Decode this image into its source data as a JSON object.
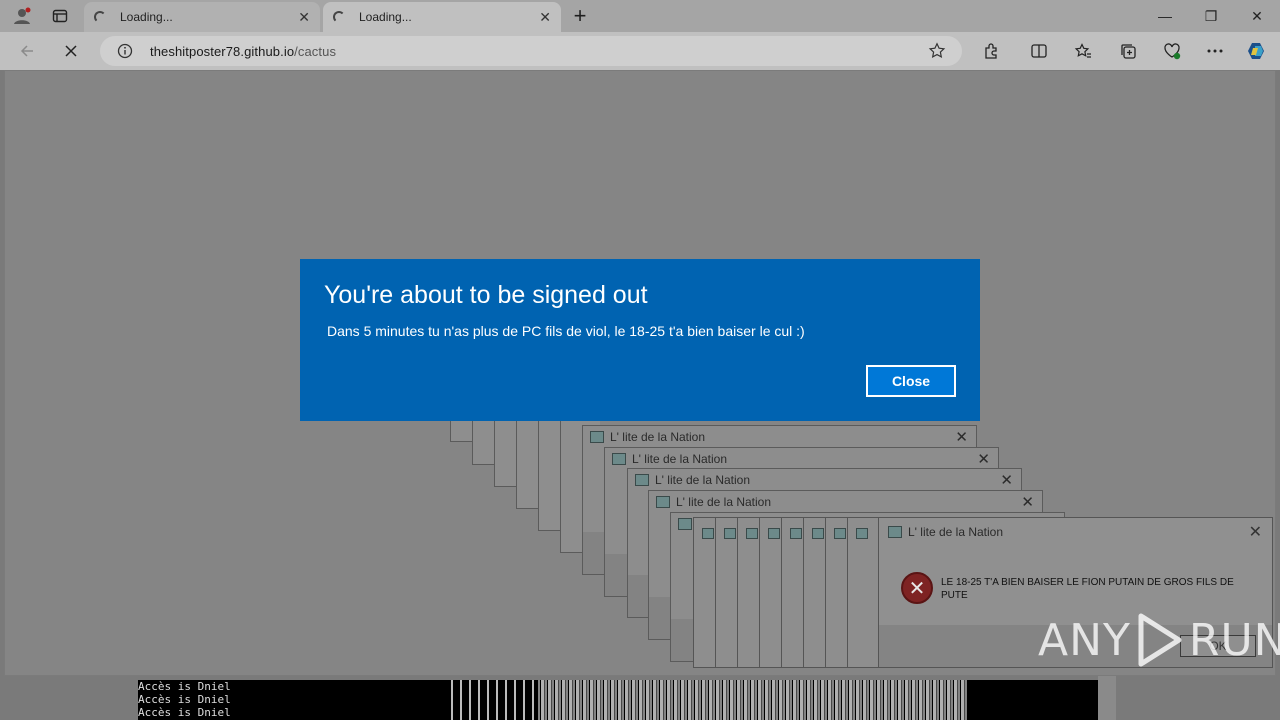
{
  "browser": {
    "tabs": [
      {
        "title": "Loading..."
      },
      {
        "title": "Loading..."
      }
    ],
    "new_tab_symbol": "+",
    "address": {
      "host": "theshitposter78.github.io",
      "path": "/cactus"
    },
    "window_controls": {
      "minimize": "—",
      "restore": "❐",
      "close": "✕"
    }
  },
  "modal": {
    "title": "You're about to be signed out",
    "message": "Dans 5 minutes tu n'as plus de PC fils de viol, le 18-25 t'a bien baiser le cul :)",
    "close_label": "Close",
    "accent_color": "#0063b1"
  },
  "dialogs": {
    "title": "L' lite de la Nation",
    "message": "LE 18-25 T'A BIEN BAISER LE FION PUTAIN DE GROS FILS DE PUTE",
    "ok_label": "OK",
    "close_symbol": "✕"
  },
  "background_text": {
    "lines": [
      "Accès is Dniel",
      "Accès is Dniel",
      "Accès is Dniel"
    ]
  },
  "watermark": {
    "left": "ANY",
    "right": "RUN"
  }
}
